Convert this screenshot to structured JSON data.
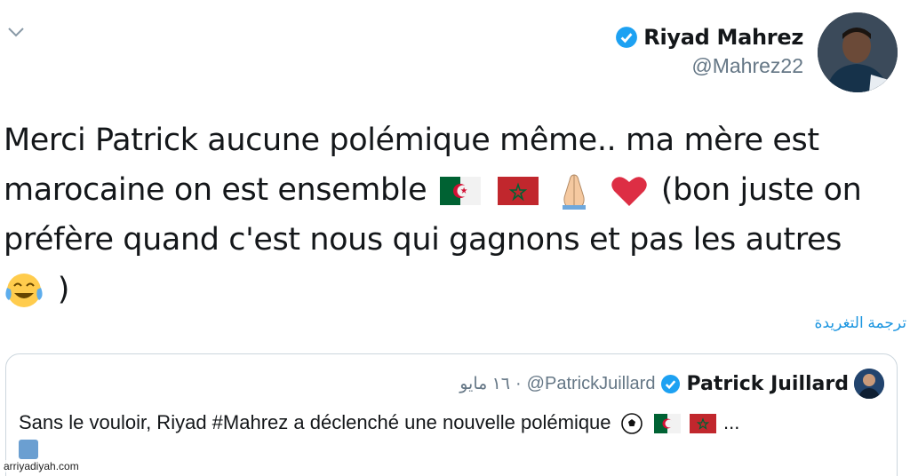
{
  "tweet": {
    "author": {
      "name": "Riyad Mahrez",
      "handle": "@Mahrez22"
    },
    "text_line1": "Merci Patrick aucune polémique même.. ma mère est",
    "text_line2a": "marocaine on est ensemble",
    "text_line2b": "(bon juste on",
    "text_line3": "préfère quand c'est nous qui gagnons et pas les autres",
    "text_line4": ")",
    "translate_label": "ترجمة التغريدة"
  },
  "quoted": {
    "name": "Patrick Juillard",
    "handle": "@PatrickJuillard",
    "separator": "·",
    "date": "١٦ مايو",
    "text": "Sans le vouloir, Riyad #Mahrez a déclenché une nouvelle polémique",
    "ellipsis": "..."
  },
  "watermark": "arriyadiyah.com",
  "icons": {
    "chevron": "chevron-down-icon",
    "verified": "verified-badge-icon",
    "emojis": [
      "algeria-flag",
      "morocco-flag",
      "folded-hands",
      "red-heart",
      "tears-of-joy",
      "soccer-ball"
    ]
  },
  "colors": {
    "link": "#1b95e0",
    "verified": "#1da1f2",
    "secondary_text": "#657786",
    "border": "#ccd6dd"
  }
}
